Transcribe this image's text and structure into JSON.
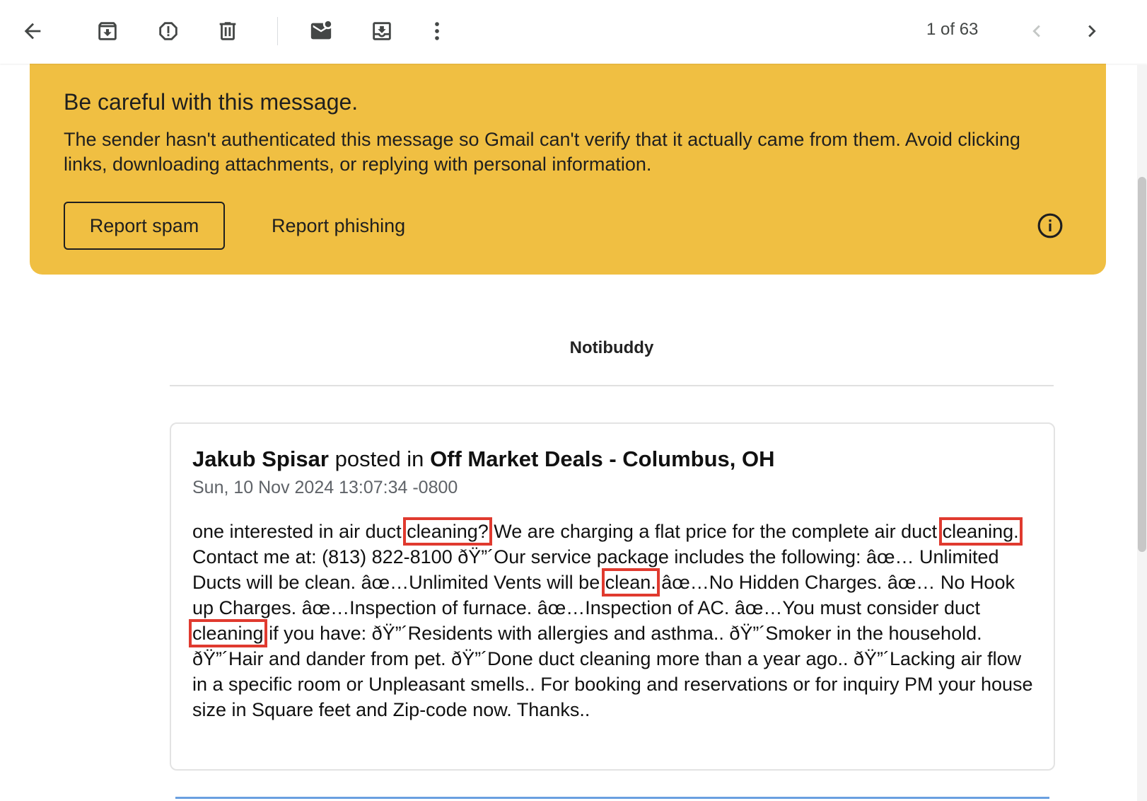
{
  "toolbar": {
    "back_icon": "arrow-left-icon",
    "archive_icon": "archive-icon",
    "report_spam_icon": "report-icon",
    "delete_icon": "trash-icon",
    "mark_unread_icon": "mark-unread-icon",
    "move_to_icon": "move-to-inbox-icon",
    "more_icon": "more-vert-icon",
    "page_count": "1 of 63",
    "prev_icon": "chevron-left-icon",
    "next_icon": "chevron-right-icon"
  },
  "warning": {
    "title": "Be careful with this message.",
    "text": "The sender hasn't authenticated this message so Gmail can't verify that it actually came from them. Avoid clicking links, downloading attachments, or replying with personal information.",
    "report_spam": "Report spam",
    "report_phishing": "Report phishing",
    "info_icon": "info-icon",
    "background_color": "#f0bf42"
  },
  "email": {
    "sender": "Notibuddy",
    "post": {
      "author": "Jakub Spisar",
      "posted_in": "posted in",
      "group": "Off Market Deals - Columbus, OH",
      "date": "Sun, 10 Nov 2024 13:07:34 -0800",
      "body": [
        "one interested in air duct ",
        "cleaning?",
        " We are charging a flat price for the complete air duct ",
        "cleaning.",
        " Contact me at: (813) 822-8100 ðŸ”´Our service package includes the following: âœ… Unlimited Ducts will be clean. âœ…Unlimited Vents will be ",
        "clean.",
        " âœ…No Hidden Charges. âœ… No Hook up Charges. âœ…Inspection of furnace. âœ…Inspection of AC. âœ…You must consider duct ",
        "cleaning",
        " if you have: ðŸ”´Residents with allergies and asthma.. ðŸ”´Smoker in the household. ðŸ”´Hair and dander from pet. ðŸ”´Done duct cleaning more than a year ago.. ðŸ”´Lacking air flow in a specific room or Unpleasant smells.. For booking and reservations or for inquiry PM your house size in Square feet and Zip-code now. Thanks.."
      ]
    },
    "highlight_color": "#e03a2f"
  }
}
